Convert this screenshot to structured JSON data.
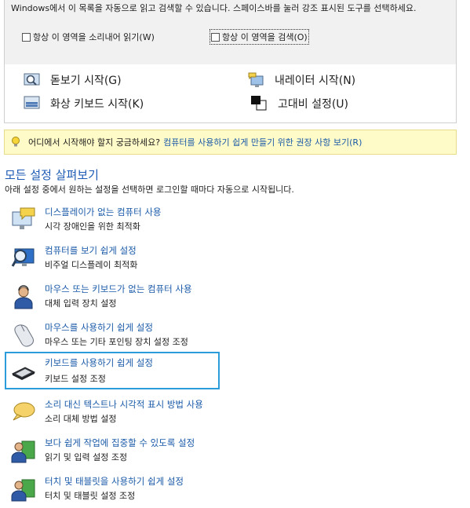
{
  "top": {
    "intro": "Windows에서 이 목록을 자동으로 읽고 검색할 수 있습니다. 스페이스바를 눌러 강조 표시된 도구를 선택하세요.",
    "checkbox_read": "항상 이 영역을 소리내어 읽기(W)",
    "checkbox_scan": "항상 이 영역을 검색(O)"
  },
  "tools": {
    "magnifier": "돋보기 시작(G)",
    "narrator": "내레이터 시작(N)",
    "osk": "화상 키보드 시작(K)",
    "contrast": "고대비 설정(U)"
  },
  "tip": {
    "text": "어디에서 시작해야 할지 궁금하세요?",
    "link": "컴퓨터를 사용하기 쉽게 만들기 위한 권장 사항 보기(R)"
  },
  "section": {
    "title": "모든 설정 살펴보기",
    "desc": "아래 설정 중에서 원하는 설정을 선택하면 로그인할 때마다 자동으로 시작됩니다."
  },
  "items": [
    {
      "link": "디스플레이가 없는 컴퓨터 사용",
      "sub": "시각 장애인을 위한 최적화",
      "icon": "monitor-speech-icon"
    },
    {
      "link": "컴퓨터를 보기 쉽게 설정",
      "sub": "비주얼 디스플레이 최적화",
      "icon": "magnifier-monitor-icon"
    },
    {
      "link": "마우스 또는 키보드가 없는 컴퓨터 사용",
      "sub": "대체 입력 장치 설정",
      "icon": "person-headset-icon"
    },
    {
      "link": "마우스를 사용하기 쉽게 설정",
      "sub": "마우스 또는 기타 포인팅 장치 설정 조정",
      "icon": "mouse-icon"
    },
    {
      "link": "키보드를 사용하기 쉽게 설정",
      "sub": "키보드 설정 조정",
      "icon": "keyboard-icon"
    },
    {
      "link": "소리 대신 텍스트나 시각적 표시 방법 사용",
      "sub": "소리 대체 방법 설정",
      "icon": "speech-bubble-icon"
    },
    {
      "link": "보다 쉽게 작업에 집중할 수 있도록 설정",
      "sub": "읽기 및 입력 설정 조정",
      "icon": "person-board-icon"
    },
    {
      "link": "터치 및 태블릿을 사용하기 쉽게 설정",
      "sub": "터치 및 태블릿 설정 조정",
      "icon": "person-tablet-icon"
    }
  ]
}
